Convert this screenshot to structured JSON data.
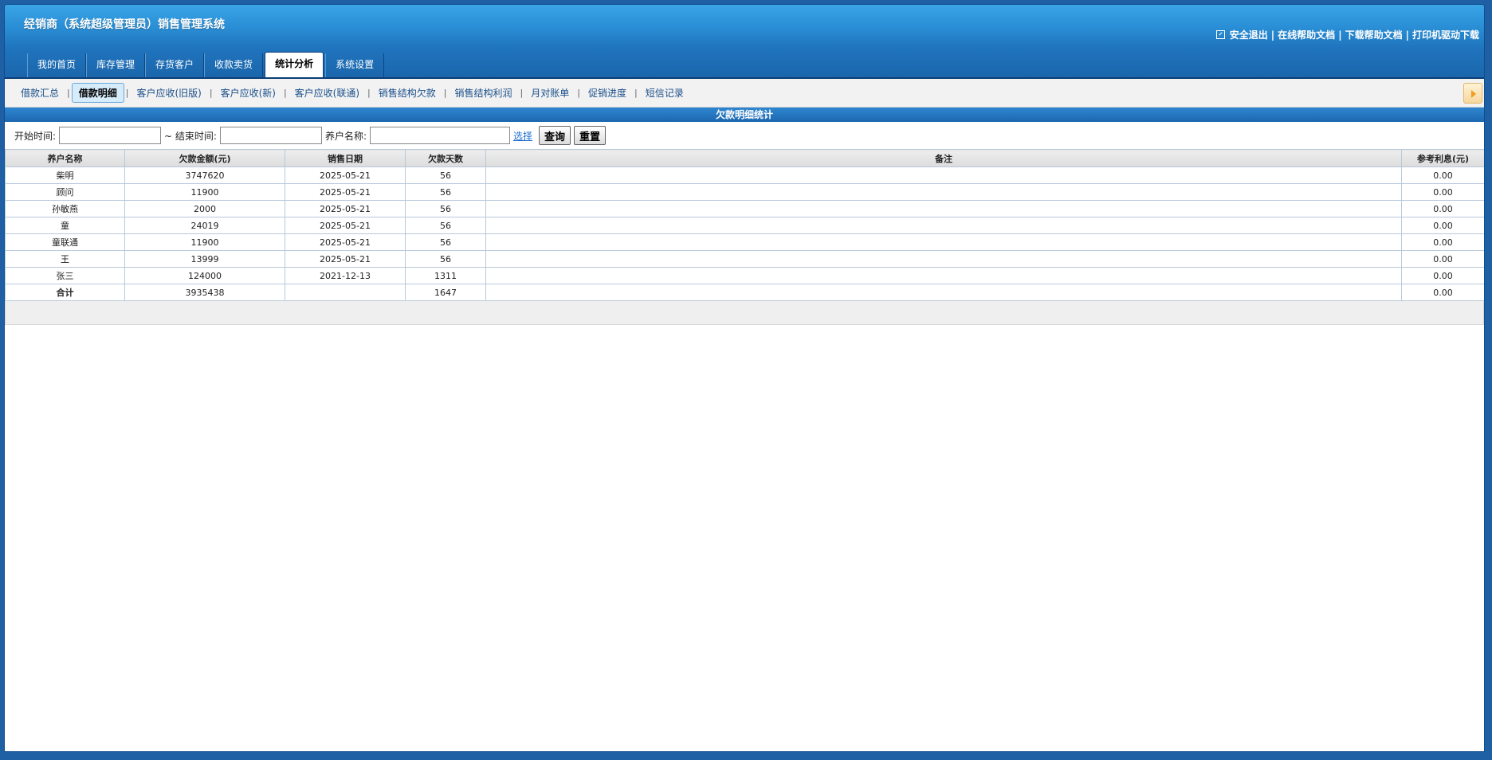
{
  "app": {
    "title": "经销商（系统超级管理员）销售管理系统"
  },
  "top_links": {
    "logout": "安全退出",
    "online_help": "在线帮助文档",
    "download_help": "下载帮助文档",
    "printer_driver": "打印机驱动下载",
    "separator": "|"
  },
  "main_tabs": [
    {
      "label": "我的首页"
    },
    {
      "label": "库存管理"
    },
    {
      "label": "存货客户"
    },
    {
      "label": "收款卖货"
    },
    {
      "label": "统计分析",
      "active": true
    },
    {
      "label": "系统设置"
    }
  ],
  "sub_tabs": [
    {
      "label": "借款汇总"
    },
    {
      "label": "借款明细",
      "active": true
    },
    {
      "label": "客户应收(旧版)"
    },
    {
      "label": "客户应收(新)"
    },
    {
      "label": "客户应收(联通)"
    },
    {
      "label": "销售结构欠款"
    },
    {
      "label": "销售结构利润"
    },
    {
      "label": "月对账单"
    },
    {
      "label": "促销进度"
    },
    {
      "label": "短信记录"
    }
  ],
  "section_title": "欠款明细统计",
  "filter": {
    "start_label": "开始时间:",
    "start_value": "",
    "end_label": "~ 结束时间:",
    "end_value": "",
    "name_label": "养户名称:",
    "name_value": "",
    "choose_link": "选择",
    "query_button": "查询",
    "reset_button": "重置"
  },
  "table": {
    "headers": [
      "养户名称",
      "欠款金额(元)",
      "销售日期",
      "欠款天数",
      "备注",
      "参考利息(元)"
    ],
    "rows": [
      [
        "柴明",
        "3747620",
        "2025-05-21",
        "56",
        "",
        "0.00"
      ],
      [
        "顾问",
        "11900",
        "2025-05-21",
        "56",
        "",
        "0.00"
      ],
      [
        "孙敏燕",
        "2000",
        "2025-05-21",
        "56",
        "",
        "0.00"
      ],
      [
        "童",
        "24019",
        "2025-05-21",
        "56",
        "",
        "0.00"
      ],
      [
        "童联通",
        "11900",
        "2025-05-21",
        "56",
        "",
        "0.00"
      ],
      [
        "王",
        "13999",
        "2025-05-21",
        "56",
        "",
        "0.00"
      ],
      [
        "张三",
        "124000",
        "2021-12-13",
        "1311",
        "",
        "0.00"
      ]
    ],
    "total": [
      "合计",
      "3935438",
      "",
      "1647",
      "",
      "0.00"
    ]
  },
  "colors": {
    "header_blue": "#1f74bd",
    "section_blue": "#1d67b0",
    "link_blue": "#1b4f8a"
  }
}
